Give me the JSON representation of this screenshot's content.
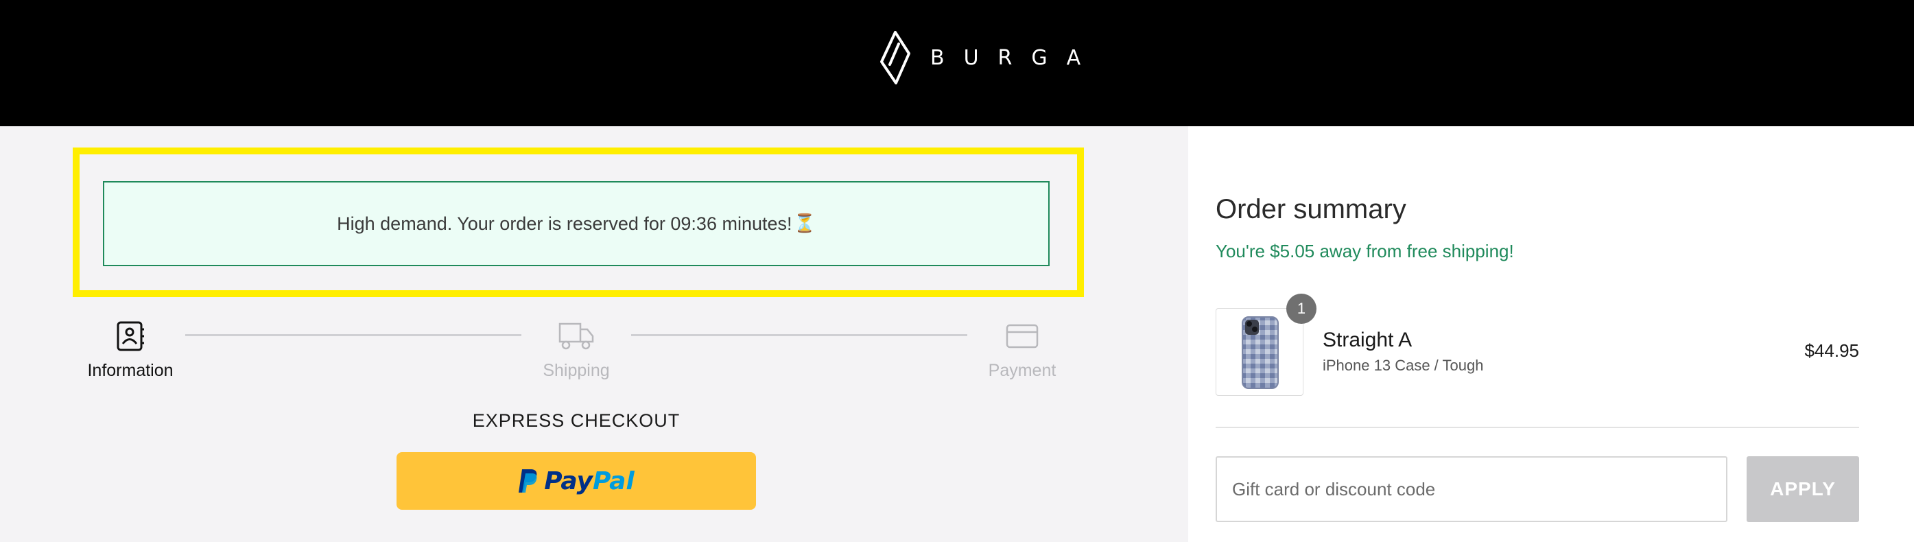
{
  "brand": {
    "name": "BURGA",
    "logo_icon": "burga-diamond-logo"
  },
  "notice": {
    "text": "High demand. Your order is reserved for 09:36 minutes!",
    "icon": "hourglass-icon",
    "glyph": "⏳"
  },
  "steps": [
    {
      "label": "Information",
      "icon": "contact-book-icon",
      "state": "active"
    },
    {
      "label": "Shipping",
      "icon": "truck-icon",
      "state": "inactive"
    },
    {
      "label": "Payment",
      "icon": "credit-card-icon",
      "state": "inactive"
    }
  ],
  "express": {
    "heading": "EXPRESS CHECKOUT",
    "paypal_pay": "Pay",
    "paypal_pal": "Pal"
  },
  "summary": {
    "title": "Order summary",
    "free_shipping": "You're $5.05 away from free shipping!",
    "item": {
      "quantity": "1",
      "name": "Straight A",
      "variant": "iPhone 13 Case / Tough",
      "price": "$44.95"
    },
    "discount": {
      "placeholder": "Gift card or discount code",
      "value": "",
      "apply_label": "APPLY"
    }
  },
  "colors": {
    "header_bg": "#000000",
    "highlight": "#ffee00",
    "notice_border": "#1f8a5b",
    "notice_bg": "#ecfdf6",
    "success_text": "#1f8a5b",
    "paypal_yellow": "#ffc439",
    "paypal_dark_blue": "#003087",
    "paypal_light_blue": "#009cde",
    "apply_disabled": "#c8c8ca"
  }
}
